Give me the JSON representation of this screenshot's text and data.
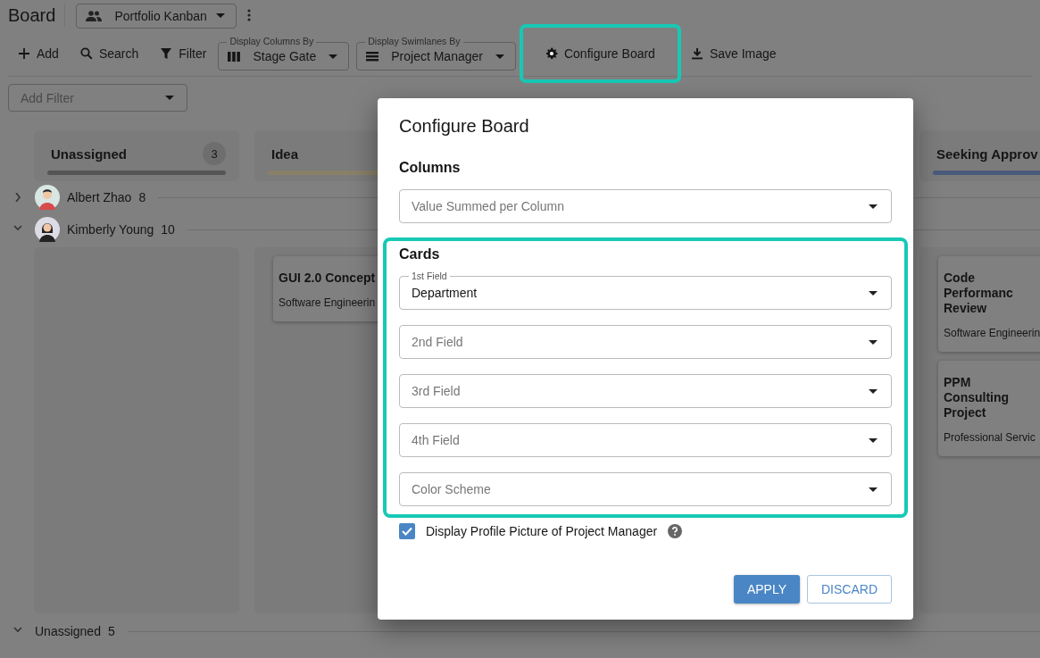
{
  "app": {
    "title": "Board",
    "view_selector": {
      "value": "Portfolio Kanban"
    }
  },
  "toolbar": {
    "items": [
      {
        "kind": "button",
        "label": "Add",
        "highlighted": false
      },
      {
        "kind": "button",
        "label": "Search",
        "highlighted": false
      },
      {
        "kind": "button",
        "label": "Filter",
        "highlighted": false
      },
      {
        "kind": "select",
        "floating_label": "Display Columns By",
        "value": "Stage Gate"
      },
      {
        "kind": "select",
        "floating_label": "Display Swimlanes By",
        "value": "Project Manager"
      },
      {
        "kind": "button",
        "label": "Configure Board",
        "highlighted": true
      },
      {
        "kind": "button",
        "label": "Save Image",
        "highlighted": false
      }
    ]
  },
  "filter": {
    "placeholder": "Add Filter"
  },
  "board": {
    "columns": [
      {
        "title": "Unassigned",
        "count": "3",
        "color": "#555555"
      },
      {
        "title": "Idea",
        "color": "#8a8068"
      },
      {
        "title": "Seeking Approv",
        "color": "#4a5a7a"
      }
    ],
    "swimlanes": [
      {
        "name": "Albert Zhao",
        "count": "8",
        "expanded": false
      },
      {
        "name": "Kimberly Young",
        "count": "10",
        "expanded": true,
        "column_areas": [
          {
            "kind": "empty"
          },
          {
            "kind": "cards",
            "cards": [
              {
                "title": "GUI 2.0 Concept",
                "department": "Software Engineerin"
              }
            ]
          },
          {
            "kind": "cards",
            "cards": [
              {
                "title": "Code Performanc Review",
                "department": "Software Engineerin"
              },
              {
                "title": "PPM Consulting Project",
                "department": "Professional Servic"
              }
            ]
          }
        ]
      },
      {
        "name": "Unassigned",
        "count": "5",
        "expanded": true
      }
    ]
  },
  "dialog": {
    "title": "Configure Board",
    "sections": [
      {
        "heading": "Columns",
        "highlighted": false,
        "fields": [
          {
            "placeholder": "Value Summed per Column"
          }
        ]
      },
      {
        "heading": "Cards",
        "highlighted": true,
        "fields": [
          {
            "label": "1st Field",
            "value": "Department"
          },
          {
            "placeholder": "2nd Field"
          },
          {
            "placeholder": "3rd Field"
          },
          {
            "placeholder": "4th Field"
          },
          {
            "placeholder": "Color Scheme"
          }
        ]
      }
    ],
    "checkbox": {
      "label": "Display Profile Picture of Project Manager",
      "checked": true
    },
    "buttons": [
      {
        "label": "APPLY",
        "kind": "primary"
      },
      {
        "label": "DISCARD",
        "kind": "secondary"
      }
    ]
  }
}
